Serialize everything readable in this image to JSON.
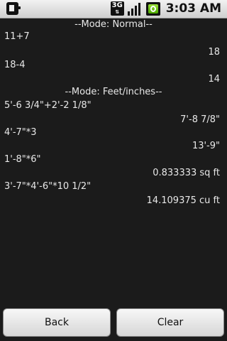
{
  "status_bar": {
    "network_type": "3G",
    "time": "3:03 AM"
  },
  "history": [
    {
      "text": "--Mode: Normal--",
      "kind": "mode"
    },
    {
      "text": "11+7",
      "kind": "expression"
    },
    {
      "text": "18",
      "kind": "result"
    },
    {
      "text": "18-4",
      "kind": "expression"
    },
    {
      "text": "14",
      "kind": "result"
    },
    {
      "text": "--Mode: Feet/inches--",
      "kind": "mode"
    },
    {
      "text": "5'-6 3/4\"+2'-2 1/8\"",
      "kind": "expression"
    },
    {
      "text": "7'-8 7/8\"",
      "kind": "result"
    },
    {
      "text": "4'-7\"*3",
      "kind": "expression"
    },
    {
      "text": "13'-9\"",
      "kind": "result"
    },
    {
      "text": "1'-8\"*6\"",
      "kind": "expression"
    },
    {
      "text": "0.833333 sq ft",
      "kind": "result"
    },
    {
      "text": "3'-7\"*4'-6\"*10 1/2\"",
      "kind": "expression"
    },
    {
      "text": "14.109375 cu ft",
      "kind": "result"
    }
  ],
  "buttons": {
    "back_label": "Back",
    "clear_label": "Clear"
  }
}
